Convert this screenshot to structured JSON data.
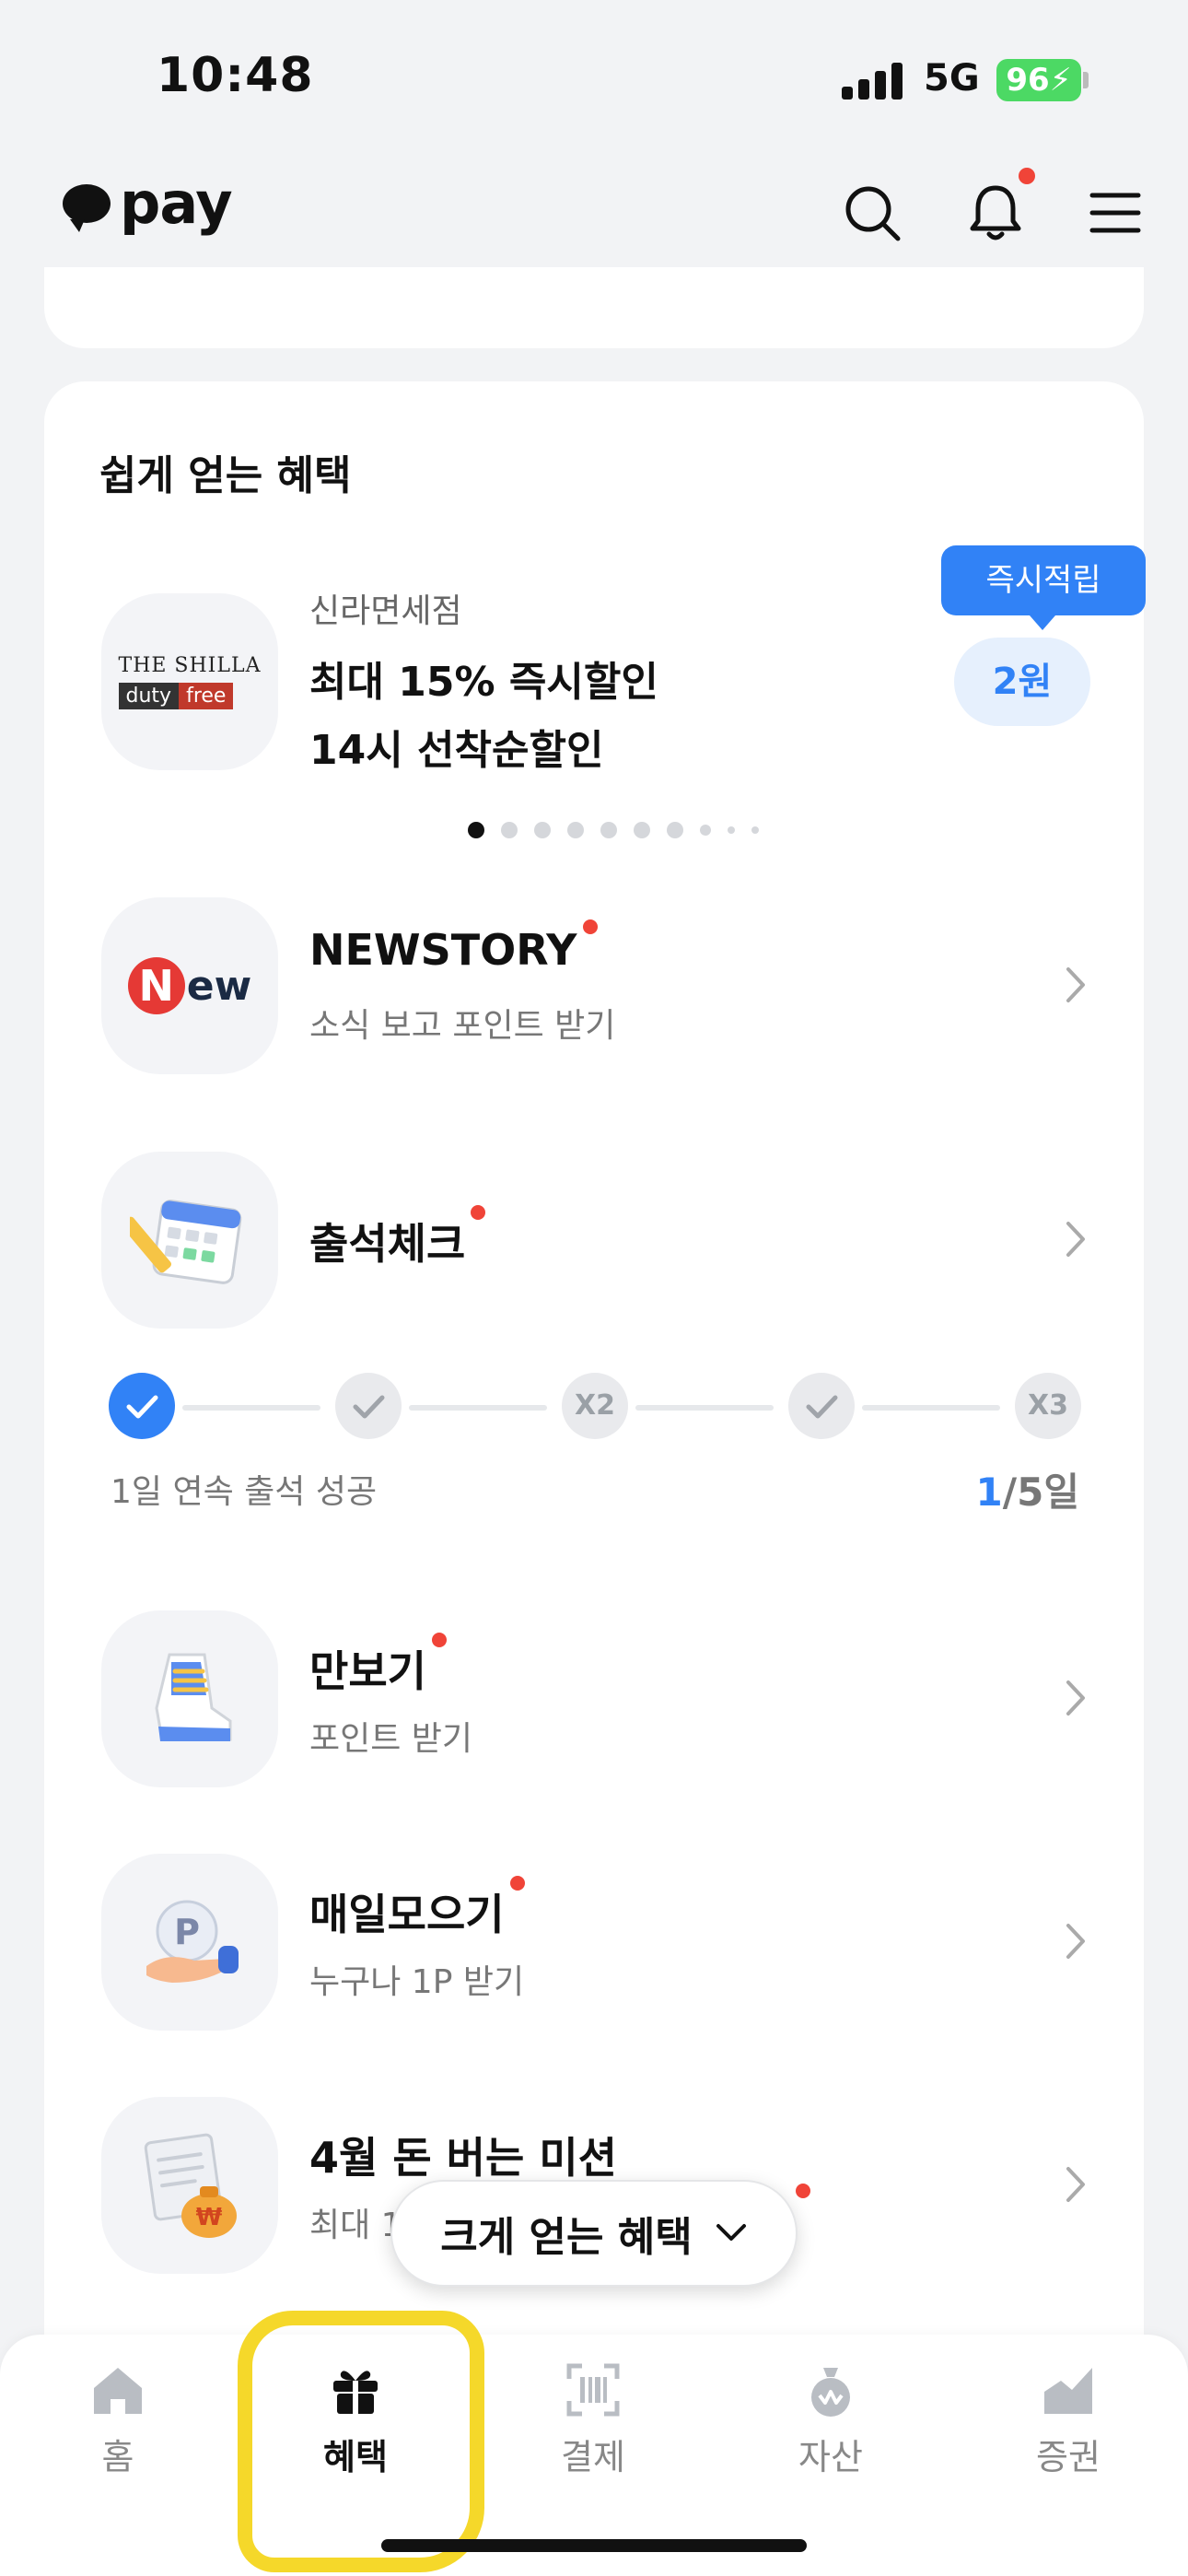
{
  "status_bar": {
    "time": "10:48",
    "network": "5G",
    "battery": "96"
  },
  "header": {
    "logo_text": "pay"
  },
  "easy_benefits": {
    "title": "쉽게 얻는 혜택",
    "promo": {
      "store": "신라면세점",
      "logo_line1": "THE SHILLA",
      "logo_line2_a": "duty",
      "logo_line2_b": "free",
      "line1": "최대 15% 즉시할인",
      "line2": "14시 선착순할인",
      "badge": "즉시적립",
      "reward": "2원"
    },
    "items": [
      {
        "title": "NEWSTORY",
        "subtitle": "소식 보고 포인트 받기"
      },
      {
        "title": "출석체크",
        "subtitle": ""
      },
      {
        "title": "만보기",
        "subtitle": "포인트 받기"
      },
      {
        "title": "매일모으기",
        "subtitle": "누구나 1P 받기"
      },
      {
        "title": "4월 돈 버는 미션",
        "subtitle": "최대 1"
      }
    ],
    "attendance": {
      "nodes": [
        "✓",
        "✓",
        "X2",
        "✓",
        "X3"
      ],
      "streak_text": "1일 연속 출석 성공",
      "current": "1",
      "total": "/5일"
    }
  },
  "floating_button": {
    "label": "크게 얻는 혜택"
  },
  "bottom_nav": {
    "items": [
      {
        "label": "홈",
        "icon": "home-icon"
      },
      {
        "label": "혜택",
        "icon": "gift-icon"
      },
      {
        "label": "결제",
        "icon": "barcode-scan-icon"
      },
      {
        "label": "자산",
        "icon": "money-bag-icon"
      },
      {
        "label": "증권",
        "icon": "stock-chart-icon"
      }
    ],
    "active": "혜택"
  },
  "colors": {
    "accent": "#3182f6",
    "notification": "#f04438",
    "highlight": "#f5d82a"
  }
}
